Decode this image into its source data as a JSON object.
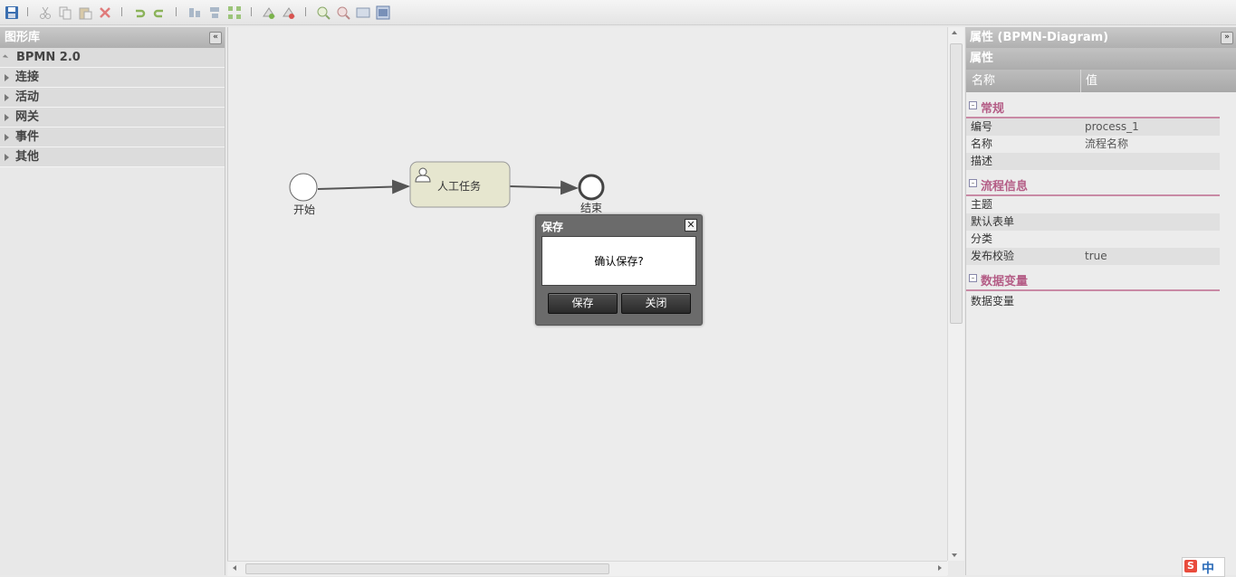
{
  "toolbar": {
    "buttons": [
      "save-icon",
      "cut-icon",
      "copy-icon",
      "paste-icon",
      "delete-icon",
      "undo-icon",
      "redo-icon",
      "align-vertical-icon",
      "align-horizontal-icon",
      "group-icon",
      "add-shape-icon",
      "remove-shape-icon",
      "zoom-in-icon",
      "zoom-out-icon",
      "fit-width-icon",
      "fit-page-icon"
    ]
  },
  "left_panel": {
    "title": "图形库",
    "items": [
      {
        "label": "BPMN 2.0",
        "open": true
      },
      {
        "label": "连接"
      },
      {
        "label": "活动"
      },
      {
        "label": "网关"
      },
      {
        "label": "事件"
      },
      {
        "label": "其他"
      }
    ]
  },
  "diagram": {
    "start_label": "开始",
    "task_label": "人工任务",
    "end_label": "结束"
  },
  "dialog": {
    "title": "保存",
    "message": "确认保存?",
    "save_button": "保存",
    "close_button": "关闭",
    "close_glyph": "✕"
  },
  "right_panel": {
    "title": "属性 (BPMN-Diagram)",
    "subtitle": "属性",
    "col_name": "名称",
    "col_value": "值",
    "groups": [
      {
        "label": "常规",
        "rows": [
          {
            "key": "编号",
            "value": "process_1"
          },
          {
            "key": "名称",
            "value": "流程名称"
          },
          {
            "key": "描述",
            "value": ""
          }
        ]
      },
      {
        "label": "流程信息",
        "rows": [
          {
            "key": "主题",
            "value": ""
          },
          {
            "key": "默认表单",
            "value": ""
          },
          {
            "key": "分类",
            "value": ""
          },
          {
            "key": "发布校验",
            "value": "true"
          }
        ]
      },
      {
        "label": "数据变量",
        "rows": [
          {
            "key": "数据变量",
            "value": ""
          }
        ]
      }
    ]
  },
  "ime": {
    "brand": "S",
    "mode": "中"
  },
  "colors": {
    "accent": "#b45d86",
    "task_fill": "#e6e6cf",
    "dialog": "#6b6b6b"
  }
}
